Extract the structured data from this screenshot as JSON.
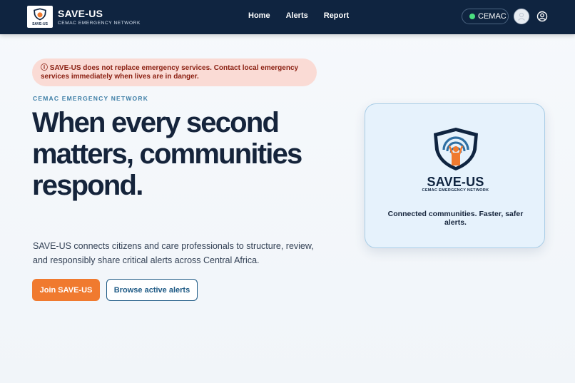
{
  "header": {
    "brand_name": "SAVE-US",
    "brand_subtitle": "CEMAC EMERGENCY NETWORK",
    "logo_text": "SAVE-US",
    "nav": [
      {
        "label": "Home"
      },
      {
        "label": "Alerts"
      },
      {
        "label": "Report"
      }
    ],
    "region": "CEMAC",
    "region_status_color": "#4ade80",
    "avatar_icon": "avatar-placeholder-icon",
    "account_icon": "user-circle-icon"
  },
  "banner": {
    "icon": "info-circle-icon",
    "icon_glyph": "ⓘ",
    "text": "SAVE-US does not replace emergency services. Contact local emergency services immediately when lives are in danger."
  },
  "hero": {
    "eyebrow": "CEMAC EMERGENCY NETWORK",
    "headline": "When every second matters, communities respond.",
    "lead": "SAVE-US connects citizens and care professionals to structure, review, and responsibly share critical alerts across Central Africa.",
    "primary_cta": "Join SAVE-US",
    "secondary_cta": "Browse active alerts"
  },
  "card": {
    "brand": "SAVE-US",
    "brand_subtitle": "CEMAC EMERGENCY NETWORK",
    "tagline": "Connected communities. Faster, safer alerts."
  },
  "colors": {
    "header_bg": "#0f2440",
    "accent_orange": "#f07a2f",
    "accent_blue": "#1e5a85",
    "banner_bg": "#fadbd5",
    "banner_text": "#8a1f11"
  }
}
